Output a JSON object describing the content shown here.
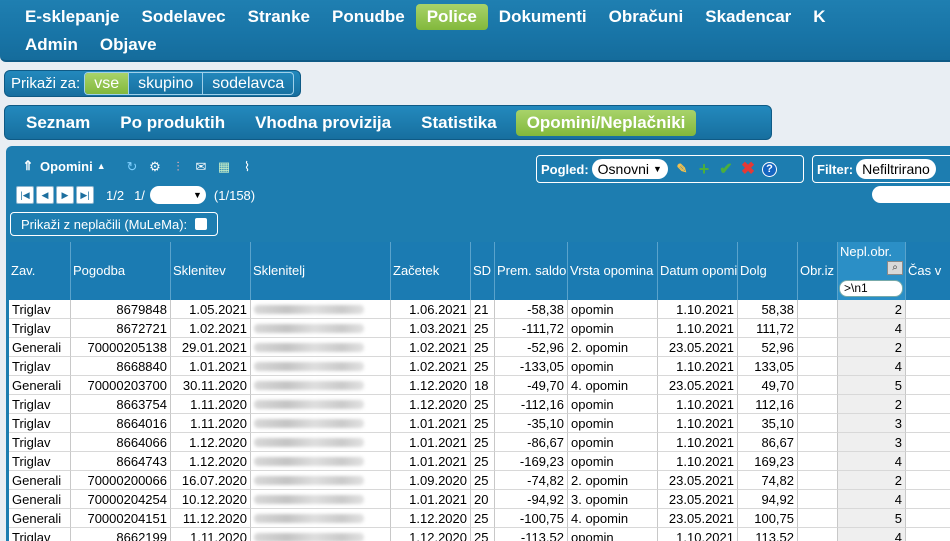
{
  "nav": {
    "row1": [
      "E-sklepanje",
      "Sodelavec",
      "Stranke",
      "Ponudbe",
      "Police",
      "Dokumenti",
      "Obračuni",
      "Skadencar",
      "K"
    ],
    "row2": [
      "Admin",
      "Objave"
    ],
    "active": "Police"
  },
  "show_for": {
    "label": "Prikaži za:",
    "options": [
      "vse",
      "skupino",
      "sodelavca"
    ],
    "active": "vse"
  },
  "subtabs": {
    "items": [
      "Seznam",
      "Po produktih",
      "Vhodna provizija",
      "Statistika",
      "Opomini/Neplačniki"
    ],
    "active": "Opomini/Neplačniki"
  },
  "toolbar": {
    "title": "Opomini",
    "icons": [
      "collapse-icon",
      "refresh-icon",
      "settings-icon",
      "columns-icon",
      "email-icon",
      "export-excel-icon",
      "attach-icon"
    ],
    "view_label": "Pogled:",
    "view_value": "Osnovni",
    "filter_label": "Filter:",
    "filter_value": "Nefiltrirano"
  },
  "pager": {
    "page_text": "1/2",
    "page_select_text": "1/",
    "count_text": "(1/158)"
  },
  "unpaid_toggle": {
    "label": "Prikaži z neplačili (MuLeMa):"
  },
  "grid": {
    "columns": [
      "Zav.",
      "Pogodba",
      "Sklenitev",
      "Sklenitelj",
      "Začetek",
      "SD",
      "Prem. saldo",
      "Vrsta opomina",
      "Datum opomina",
      "Dolg",
      "Obr.iz",
      "Nepl.obr.",
      "Čas v"
    ],
    "nepl_filter": ">\\n1",
    "rows": [
      [
        "Triglav",
        "8679848",
        "1.05.2021",
        "",
        "1.06.2021",
        "21",
        "-58,38",
        "opomin",
        "1.10.2021",
        "58,38",
        "",
        "2"
      ],
      [
        "Triglav",
        "8672721",
        "1.02.2021",
        "",
        "1.03.2021",
        "25",
        "-111,72",
        "opomin",
        "1.10.2021",
        "111,72",
        "",
        "4"
      ],
      [
        "Generali",
        "70000205138",
        "29.01.2021",
        "",
        "1.02.2021",
        "25",
        "-52,96",
        "2. opomin",
        "23.05.2021",
        "52,96",
        "",
        "2"
      ],
      [
        "Triglav",
        "8668840",
        "1.01.2021",
        "",
        "1.02.2021",
        "25",
        "-133,05",
        "opomin",
        "1.10.2021",
        "133,05",
        "",
        "4"
      ],
      [
        "Generali",
        "70000203700",
        "30.11.2020",
        "",
        "1.12.2020",
        "18",
        "-49,70",
        "4. opomin",
        "23.05.2021",
        "49,70",
        "",
        "5"
      ],
      [
        "Triglav",
        "8663754",
        "1.11.2020",
        "",
        "1.12.2020",
        "25",
        "-112,16",
        "opomin",
        "1.10.2021",
        "112,16",
        "",
        "2"
      ],
      [
        "Triglav",
        "8664016",
        "1.11.2020",
        "",
        "1.01.2021",
        "25",
        "-35,10",
        "opomin",
        "1.10.2021",
        "35,10",
        "",
        "3"
      ],
      [
        "Triglav",
        "8664066",
        "1.12.2020",
        "",
        "1.01.2021",
        "25",
        "-86,67",
        "opomin",
        "1.10.2021",
        "86,67",
        "",
        "3"
      ],
      [
        "Triglav",
        "8664743",
        "1.12.2020",
        "",
        "1.01.2021",
        "25",
        "-169,23",
        "opomin",
        "1.10.2021",
        "169,23",
        "",
        "4"
      ],
      [
        "Generali",
        "70000200066",
        "16.07.2020",
        "",
        "1.09.2020",
        "25",
        "-74,82",
        "2. opomin",
        "23.05.2021",
        "74,82",
        "",
        "2"
      ],
      [
        "Generali",
        "70000204254",
        "10.12.2020",
        "",
        "1.01.2021",
        "20",
        "-94,92",
        "3. opomin",
        "23.05.2021",
        "94,92",
        "",
        "4"
      ],
      [
        "Generali",
        "70000204151",
        "11.12.2020",
        "",
        "1.12.2020",
        "25",
        "-100,75",
        "4. opomin",
        "23.05.2021",
        "100,75",
        "",
        "5"
      ],
      [
        "Triglav",
        "8662199",
        "1.11.2020",
        "",
        "1.12.2020",
        "25",
        "-113,52",
        "opomin",
        "1.10.2021",
        "113,52",
        "",
        "4"
      ]
    ]
  }
}
